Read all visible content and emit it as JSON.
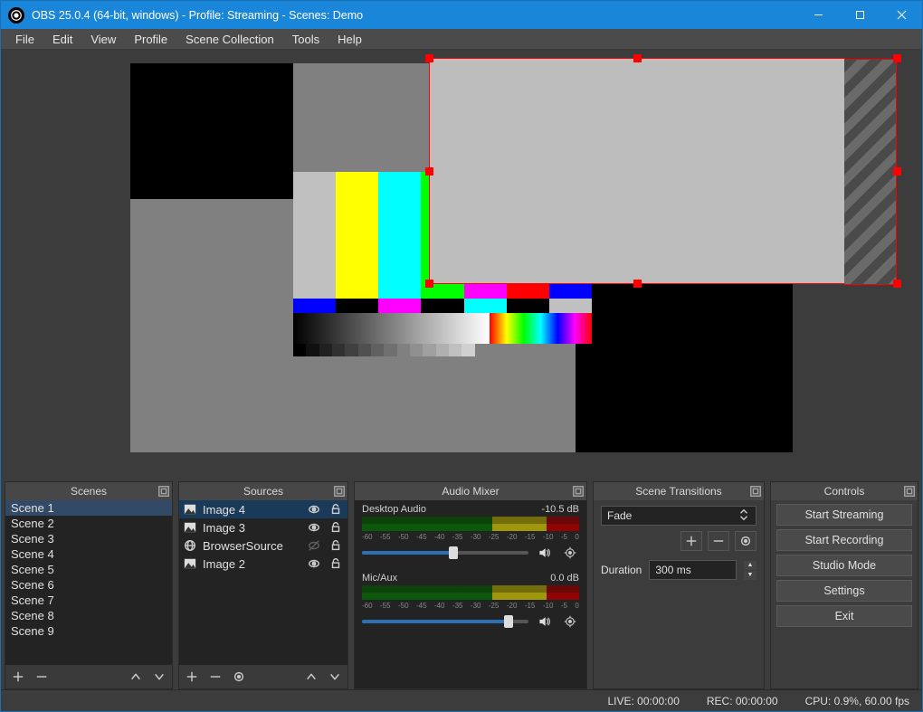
{
  "titlebar": {
    "title": "OBS 25.0.4 (64-bit, windows) - Profile: Streaming - Scenes: Demo"
  },
  "menubar": {
    "items": [
      "File",
      "Edit",
      "View",
      "Profile",
      "Scene Collection",
      "Tools",
      "Help"
    ]
  },
  "panels": {
    "scenes": {
      "title": "Scenes",
      "items": [
        "Scene 1",
        "Scene 2",
        "Scene 3",
        "Scene 4",
        "Scene 5",
        "Scene 6",
        "Scene 7",
        "Scene 8",
        "Scene 9"
      ],
      "selected": 0
    },
    "sources": {
      "title": "Sources",
      "items": [
        {
          "icon": "image",
          "label": "Image 4",
          "visible": true,
          "locked": false,
          "selected": true
        },
        {
          "icon": "image",
          "label": "Image 3",
          "visible": true,
          "locked": false,
          "selected": false
        },
        {
          "icon": "browser",
          "label": "BrowserSource",
          "visible": false,
          "locked": false,
          "selected": false
        },
        {
          "icon": "image",
          "label": "Image 2",
          "visible": true,
          "locked": false,
          "selected": false
        }
      ]
    },
    "mixer": {
      "title": "Audio Mixer",
      "ticks": [
        "-60",
        "-55",
        "-50",
        "-45",
        "-40",
        "-35",
        "-30",
        "-25",
        "-20",
        "-15",
        "-10",
        "-5",
        "0"
      ],
      "channels": [
        {
          "name": "Desktop Audio",
          "db": "-10.5 dB",
          "slider": 55
        },
        {
          "name": "Mic/Aux",
          "db": "0.0 dB",
          "slider": 88
        }
      ]
    },
    "transitions": {
      "title": "Scene Transitions",
      "selected": "Fade",
      "duration_label": "Duration",
      "duration_value": "300 ms"
    },
    "controls": {
      "title": "Controls",
      "buttons": [
        "Start Streaming",
        "Start Recording",
        "Studio Mode",
        "Settings",
        "Exit"
      ]
    }
  },
  "statusbar": {
    "live": "LIVE: 00:00:00",
    "rec": "REC: 00:00:00",
    "cpu": "CPU: 0.9%, 60.00 fps"
  }
}
